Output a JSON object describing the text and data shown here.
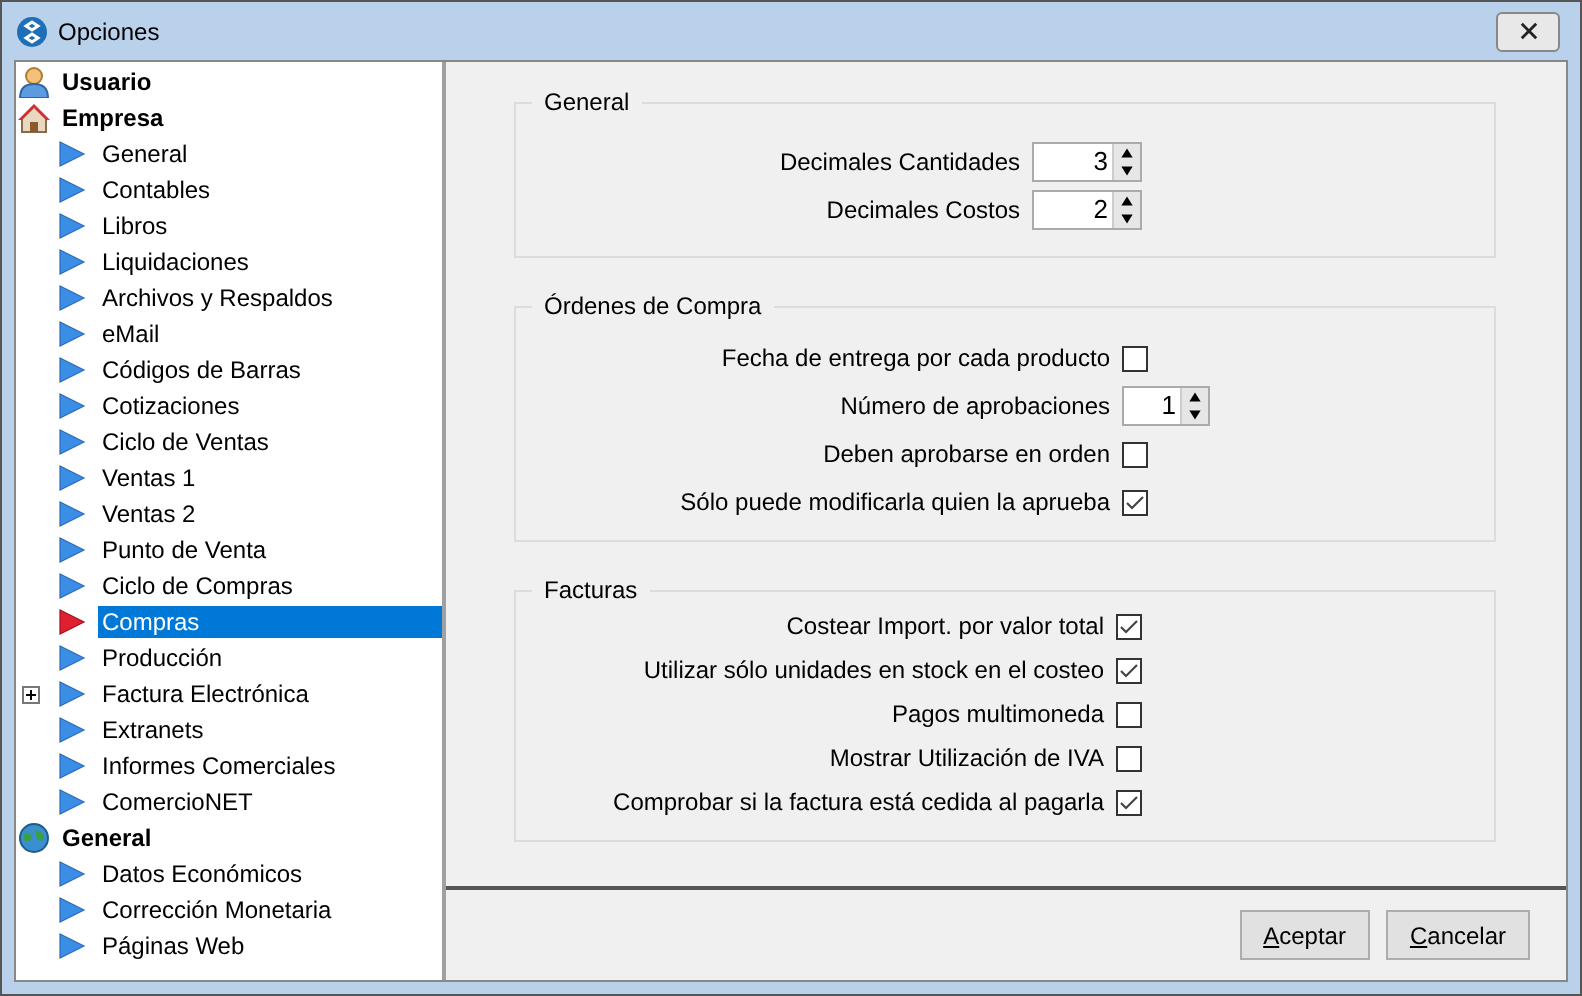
{
  "window": {
    "title": "Opciones"
  },
  "tree": [
    {
      "label": "Usuario",
      "kind": "user"
    },
    {
      "label": "Empresa",
      "kind": "house",
      "children": [
        {
          "label": "General",
          "selected": false
        },
        {
          "label": "Contables",
          "selected": false
        },
        {
          "label": "Libros",
          "selected": false
        },
        {
          "label": "Liquidaciones",
          "selected": false
        },
        {
          "label": "Archivos y Respaldos",
          "selected": false
        },
        {
          "label": "eMail",
          "selected": false
        },
        {
          "label": "Códigos de Barras",
          "selected": false
        },
        {
          "label": "Cotizaciones",
          "selected": false
        },
        {
          "label": "Ciclo de Ventas",
          "selected": false
        },
        {
          "label": "Ventas 1",
          "selected": false
        },
        {
          "label": "Ventas 2",
          "selected": false
        },
        {
          "label": "Punto de Venta",
          "selected": false
        },
        {
          "label": "Ciclo de Compras",
          "selected": false
        },
        {
          "label": "Compras",
          "selected": true
        },
        {
          "label": "Producción",
          "selected": false
        },
        {
          "label": "Factura Electrónica",
          "selected": false,
          "expanded": false
        },
        {
          "label": "Extranets",
          "selected": false
        },
        {
          "label": "Informes Comerciales",
          "selected": false
        },
        {
          "label": "ComercioNET",
          "selected": false
        }
      ]
    },
    {
      "label": "General",
      "kind": "globe",
      "children": [
        {
          "label": "Datos Económicos",
          "selected": false
        },
        {
          "label": "Corrección Monetaria",
          "selected": false
        },
        {
          "label": "Páginas Web",
          "selected": false
        }
      ]
    }
  ],
  "groups": [
    {
      "title": "General",
      "rows": [
        {
          "kind": "spinner",
          "label": "Decimales Cantidades",
          "value": "3"
        },
        {
          "kind": "spinner",
          "label": "Decimales Costos",
          "value": "2"
        }
      ]
    },
    {
      "title": "Órdenes de Compra",
      "rows": [
        {
          "kind": "checkbox",
          "label": "Fecha de entrega por cada producto",
          "checked": false
        },
        {
          "kind": "spinner",
          "label": "Número de aprobaciones",
          "value": "1"
        },
        {
          "kind": "checkbox",
          "label": "Deben aprobarse en orden",
          "checked": false
        },
        {
          "kind": "checkbox",
          "label": "Sólo puede modificarla quien la aprueba",
          "checked": true
        }
      ]
    },
    {
      "title": "Facturas",
      "rows": [
        {
          "kind": "checkbox",
          "label": "Costear Import. por valor total",
          "checked": true
        },
        {
          "kind": "checkbox",
          "label": "Utilizar sólo unidades en stock en el costeo",
          "checked": true
        },
        {
          "kind": "checkbox",
          "label": "Pagos multimoneda",
          "checked": false
        },
        {
          "kind": "checkbox",
          "label": "Mostrar Utilización de IVA",
          "checked": false
        },
        {
          "kind": "checkbox",
          "label": "Comprobar si la factura está cedida al pagarla",
          "checked": true
        }
      ]
    }
  ],
  "buttons": [
    "Aceptar",
    "Cancelar"
  ]
}
